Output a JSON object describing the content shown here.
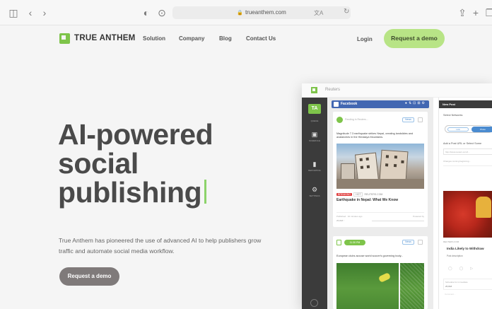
{
  "browser": {
    "url": "trueanthem.com",
    "icons": {
      "sidebar": "sidebar-icon",
      "back": "chevron-left-icon",
      "forward": "chevron-right-icon",
      "privacy": "shield-icon",
      "page": "page-settings-icon",
      "lock": "lock-icon",
      "translate": "translate-icon",
      "reload": "reload-icon",
      "share": "share-icon",
      "new_tab": "plus-icon",
      "tabs": "tab-overview-icon"
    }
  },
  "site": {
    "brand": "TRUE ANTHEM",
    "nav": {
      "solution": "Solution",
      "company": "Company",
      "blog": "Blog",
      "contact": "Contact Us",
      "login": "Login",
      "demo": "Request a demo"
    },
    "hero": {
      "line1": "AI-powered",
      "line2": "social",
      "line3": "publishing",
      "description": "True Anthem has pioneered the use of advanced AI to help publishers grow traffic and automate social media workflow.",
      "cta": "Request a demo"
    },
    "colors": {
      "accent": "#7ec44a",
      "demo_button": "#b8e486",
      "hero_cta": "#7f7a7a",
      "facebook": "#4267b2"
    }
  },
  "app": {
    "brand": "Reuters",
    "sidebar": {
      "active": "TA",
      "items": [
        {
          "label": "QUEUE",
          "icon": "queue-icon"
        },
        {
          "label": "SCHEDULE",
          "icon": "calendar-icon"
        },
        {
          "label": "REPORTING",
          "icon": "chart-icon"
        },
        {
          "label": "SETTINGS",
          "icon": "gear-icon"
        }
      ]
    },
    "feed": {
      "network": "Facebook",
      "pending": "Pending in Reuters...",
      "badge": "News",
      "post1": {
        "text": "Magnitude 7.3 earthquake strikes Nepal, creating landslides and avalanches in the Himalaya Mountains.",
        "breaking": "BREAKING",
        "tag": "HOT",
        "source": "REUTERS.COM",
        "title": "Earthquake in Nepal: What We Know",
        "published": "Published · 10 minutes ago",
        "powered": "Powered by",
        "footer": "25,818 ↑"
      },
      "post2": {
        "scheduled": "11:30 PM",
        "text": "European clubs accuse world soccer's governing body..."
      }
    },
    "newpost": {
      "title": "New Post",
      "select_label": "Select Networks",
      "toggle_off": "Link",
      "toggle_on": "Photo",
      "url_label": "Add a Post URL or Select Some",
      "url_value": "http://www.reuters.com/l...",
      "desc_placeholder": "Changes coming beginning...",
      "source": "REUTERS.COM",
      "article": "India Likely to Withdraw",
      "post_desc": "Post description",
      "schedule_label": "Schedule for immediate",
      "schedule_value": "25,818",
      "comment": "Comment..."
    }
  }
}
